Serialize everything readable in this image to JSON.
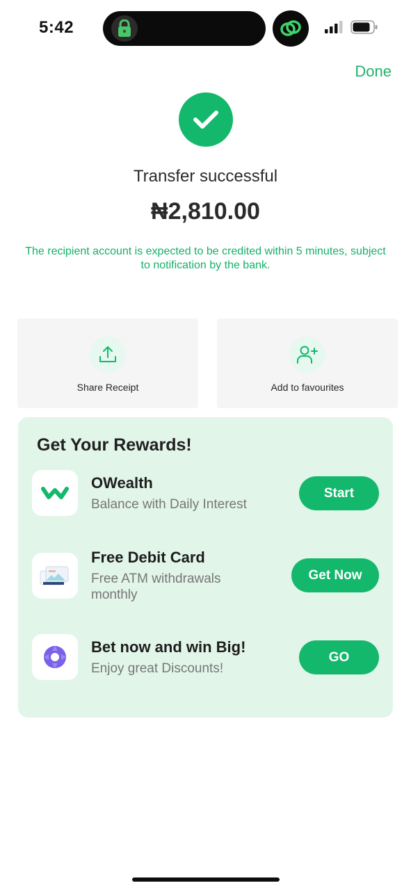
{
  "status_bar": {
    "time": "5:42"
  },
  "header": {
    "done_label": "Done"
  },
  "success": {
    "title": "Transfer successful",
    "amount": "₦2,810.00",
    "note": "The recipient account is expected to be credited within 5 minutes, subject to notification by the bank."
  },
  "actions": [
    {
      "label": "Share Receipt",
      "icon": "share-icon"
    },
    {
      "label": "Add to favourites",
      "icon": "add-user-icon"
    }
  ],
  "rewards": {
    "title": "Get Your Rewards!",
    "items": [
      {
        "title": "OWealth",
        "subtitle_lines": [
          "Balance with Daily Interest"
        ],
        "button": "Start",
        "icon": "owealth-logo-icon"
      },
      {
        "title": "Free Debit Card",
        "subtitle_lines": [
          "Free ATM withdrawals",
          "monthly"
        ],
        "button": "Get Now",
        "icon": "debit-card-icon"
      },
      {
        "title": "Bet now and win Big!",
        "subtitle_lines": [
          "Enjoy great Discounts!"
        ],
        "button": "GO",
        "icon": "bet-icon"
      }
    ]
  },
  "colors": {
    "accent": "#13b86c",
    "note_text": "#14b068",
    "rewards_bg": "#e2f5e9",
    "card_bg": "#f5f5f6"
  }
}
